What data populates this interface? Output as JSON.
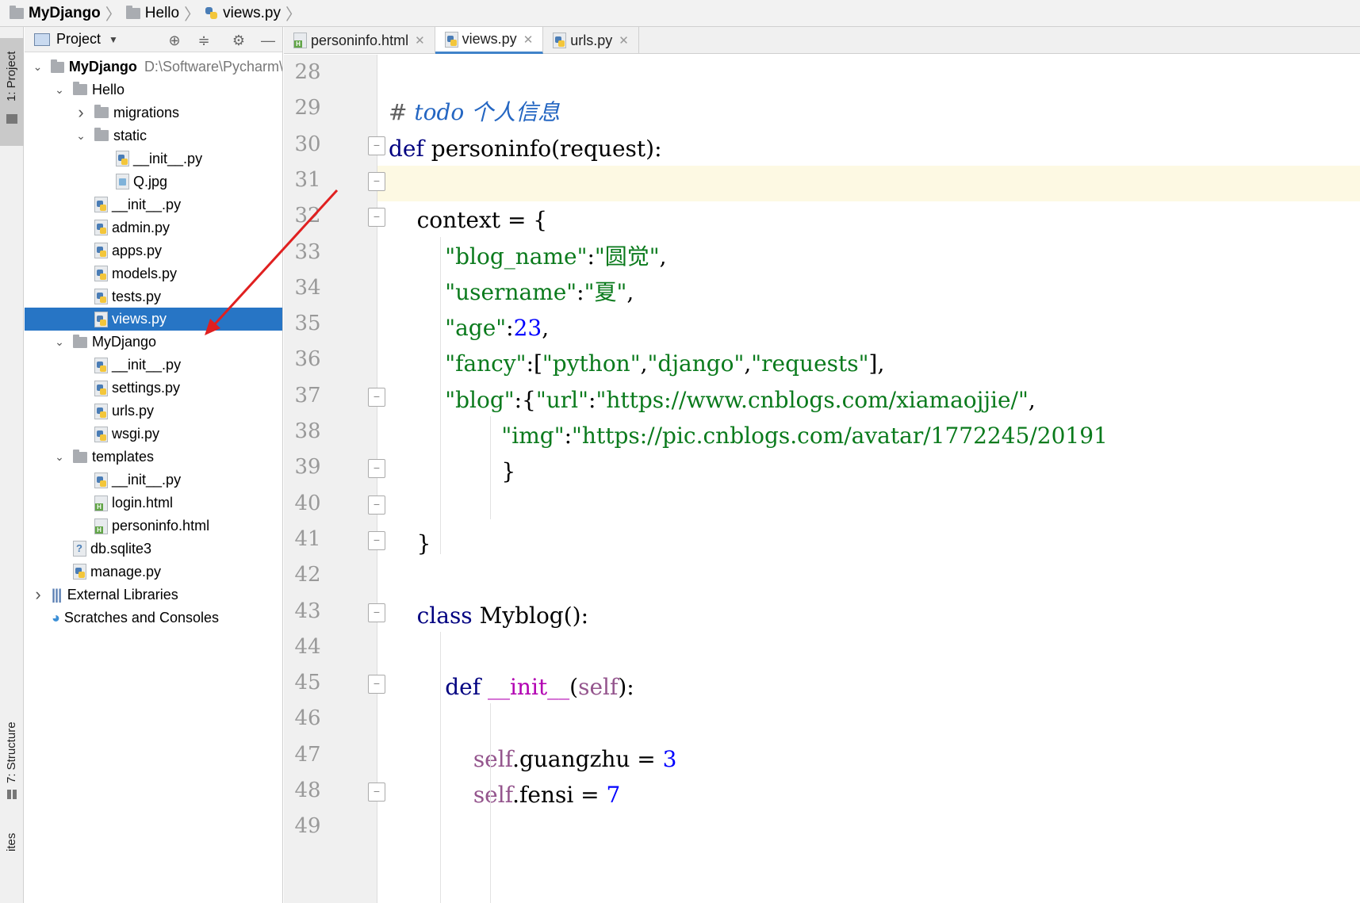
{
  "breadcrumb": [
    "MyDjango",
    "Hello",
    "views.py"
  ],
  "tool_windows": {
    "project_tab": "1: Project",
    "structure_tab": "7: Structure",
    "favorites_tab": "ites"
  },
  "project_panel": {
    "title": "Project",
    "tree": [
      {
        "label": "MyDjango",
        "path": "D:\\Software\\Pycharm\\",
        "depth": 0,
        "icon": "folder",
        "arrow": "down"
      },
      {
        "label": "Hello",
        "depth": 1,
        "icon": "folder",
        "arrow": "down"
      },
      {
        "label": "migrations",
        "depth": 2,
        "icon": "folder",
        "arrow": "right"
      },
      {
        "label": "static",
        "depth": 2,
        "icon": "folder",
        "arrow": "down"
      },
      {
        "label": "__init__.py",
        "depth": 3,
        "icon": "py"
      },
      {
        "label": "Q.jpg",
        "depth": 3,
        "icon": "img"
      },
      {
        "label": "__init__.py",
        "depth": 2,
        "icon": "py"
      },
      {
        "label": "admin.py",
        "depth": 2,
        "icon": "py"
      },
      {
        "label": "apps.py",
        "depth": 2,
        "icon": "py"
      },
      {
        "label": "models.py",
        "depth": 2,
        "icon": "py"
      },
      {
        "label": "tests.py",
        "depth": 2,
        "icon": "py"
      },
      {
        "label": "views.py",
        "depth": 2,
        "icon": "py",
        "selected": true
      },
      {
        "label": "MyDjango",
        "depth": 1,
        "icon": "folder",
        "arrow": "down"
      },
      {
        "label": "__init__.py",
        "depth": 2,
        "icon": "py"
      },
      {
        "label": "settings.py",
        "depth": 2,
        "icon": "py"
      },
      {
        "label": "urls.py",
        "depth": 2,
        "icon": "py"
      },
      {
        "label": "wsgi.py",
        "depth": 2,
        "icon": "py"
      },
      {
        "label": "templates",
        "depth": 1,
        "icon": "folder",
        "arrow": "down"
      },
      {
        "label": "__init__.py",
        "depth": 2,
        "icon": "py"
      },
      {
        "label": "login.html",
        "depth": 2,
        "icon": "html"
      },
      {
        "label": "personinfo.html",
        "depth": 2,
        "icon": "html"
      },
      {
        "label": "db.sqlite3",
        "depth": 1,
        "icon": "db"
      },
      {
        "label": "manage.py",
        "depth": 1,
        "icon": "py"
      },
      {
        "label": "External Libraries",
        "depth": 0,
        "icon": "lib",
        "arrow": "right"
      },
      {
        "label": "Scratches and Consoles",
        "depth": 0,
        "icon": "scratch"
      }
    ]
  },
  "editor_tabs": [
    {
      "label": "personinfo.html",
      "icon": "html",
      "active": false
    },
    {
      "label": "views.py",
      "icon": "py",
      "active": true
    },
    {
      "label": "urls.py",
      "icon": "py",
      "active": false
    }
  ],
  "code": {
    "line_numbers": [
      "28",
      "29",
      "30",
      "31",
      "32",
      "33",
      "34",
      "35",
      "36",
      "37",
      "38",
      "39",
      "40",
      "41",
      "42",
      "43",
      "44",
      "45",
      "46",
      "47",
      "48",
      "49"
    ],
    "lines": [
      [],
      [
        [
          "cm",
          "# "
        ],
        [
          "todo",
          "todo 个人信息"
        ]
      ],
      [
        [
          "kw",
          "def "
        ],
        [
          "",
          "personinfo(request):"
        ]
      ],
      [],
      [
        [
          "",
          "    context = {"
        ]
      ],
      [
        [
          "",
          "        "
        ],
        [
          "str",
          "\"blog_name\""
        ],
        [
          "",
          ":"
        ],
        [
          "str",
          "\"圆觉\""
        ],
        [
          "",
          ","
        ]
      ],
      [
        [
          "",
          "        "
        ],
        [
          "str",
          "\"username\""
        ],
        [
          "",
          ":"
        ],
        [
          "str",
          "\"夏\""
        ],
        [
          "",
          ","
        ]
      ],
      [
        [
          "",
          "        "
        ],
        [
          "str",
          "\"age\""
        ],
        [
          "",
          ":"
        ],
        [
          "num",
          "23"
        ],
        [
          "",
          ","
        ]
      ],
      [
        [
          "",
          "        "
        ],
        [
          "str",
          "\"fancy\""
        ],
        [
          "",
          ":["
        ],
        [
          "str",
          "\"python\""
        ],
        [
          "",
          ","
        ],
        [
          "str",
          "\"django\""
        ],
        [
          "",
          ","
        ],
        [
          "str",
          "\"requests\""
        ],
        [
          "",
          "],"
        ]
      ],
      [
        [
          "",
          "        "
        ],
        [
          "str",
          "\"blog\""
        ],
        [
          "",
          ":{"
        ],
        [
          "str",
          "\"url\""
        ],
        [
          "",
          ":"
        ],
        [
          "str",
          "\"https://www.cnblogs.com/xiamaojjie/\""
        ],
        [
          "",
          ","
        ]
      ],
      [
        [
          "",
          "                "
        ],
        [
          "str",
          "\"img\""
        ],
        [
          "",
          ":"
        ],
        [
          "str",
          "\"https://pic.cnblogs.com/avatar/1772245/20191"
        ]
      ],
      [
        [
          "",
          "                }"
        ]
      ],
      [],
      [
        [
          "",
          "    }"
        ]
      ],
      [],
      [
        [
          "",
          "    "
        ],
        [
          "kw",
          "class "
        ],
        [
          "",
          "Myblog():"
        ]
      ],
      [],
      [
        [
          "",
          "        "
        ],
        [
          "kw",
          "def "
        ],
        [
          "mg",
          "__init__"
        ],
        [
          "",
          "("
        ],
        [
          "slf",
          "self"
        ],
        [
          "",
          "):"
        ]
      ],
      [],
      [
        [
          "",
          "            "
        ],
        [
          "slf",
          "self"
        ],
        [
          "",
          ".guangzhu = "
        ],
        [
          "num",
          "3"
        ]
      ],
      [
        [
          "",
          "            "
        ],
        [
          "slf",
          "self"
        ],
        [
          "",
          ".fensi = "
        ],
        [
          "num",
          "7"
        ]
      ],
      []
    ]
  },
  "colors": {
    "selection": "#2775c5",
    "caret_line": "#fdf9e3",
    "keyword": "#000080",
    "string": "#0a7a1c",
    "number": "#0000ff",
    "annotation_arrow": "#e02020"
  }
}
